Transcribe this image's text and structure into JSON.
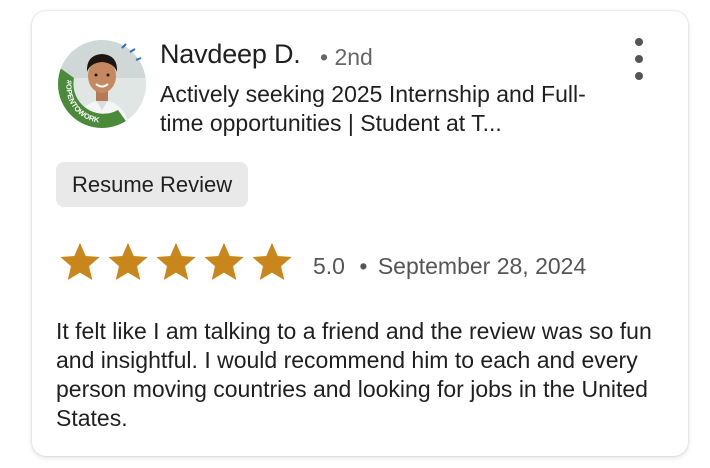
{
  "reviewer": {
    "name": "Navdeep D.",
    "degree": "• 2nd",
    "headline": "Actively seeking 2025 Internship and Full-time opportunities | Student at T...",
    "badge_text": "#OPENTOWORK"
  },
  "tag": {
    "label": "Resume Review"
  },
  "rating": {
    "value": 5.0,
    "max": 5,
    "text": "5.0",
    "separator": "•",
    "date": "September 28, 2024",
    "star_color": "#c9861a"
  },
  "review": {
    "text": "It felt like I am talking to a friend and the review was so fun and insightful. I would recommend him to each and every person moving countries and looking for jobs in the United States."
  },
  "icons": {
    "menu": "more-vertical-icon",
    "star": "star-icon"
  },
  "colors": {
    "open_to_work_ring": "#4a8a3a"
  }
}
